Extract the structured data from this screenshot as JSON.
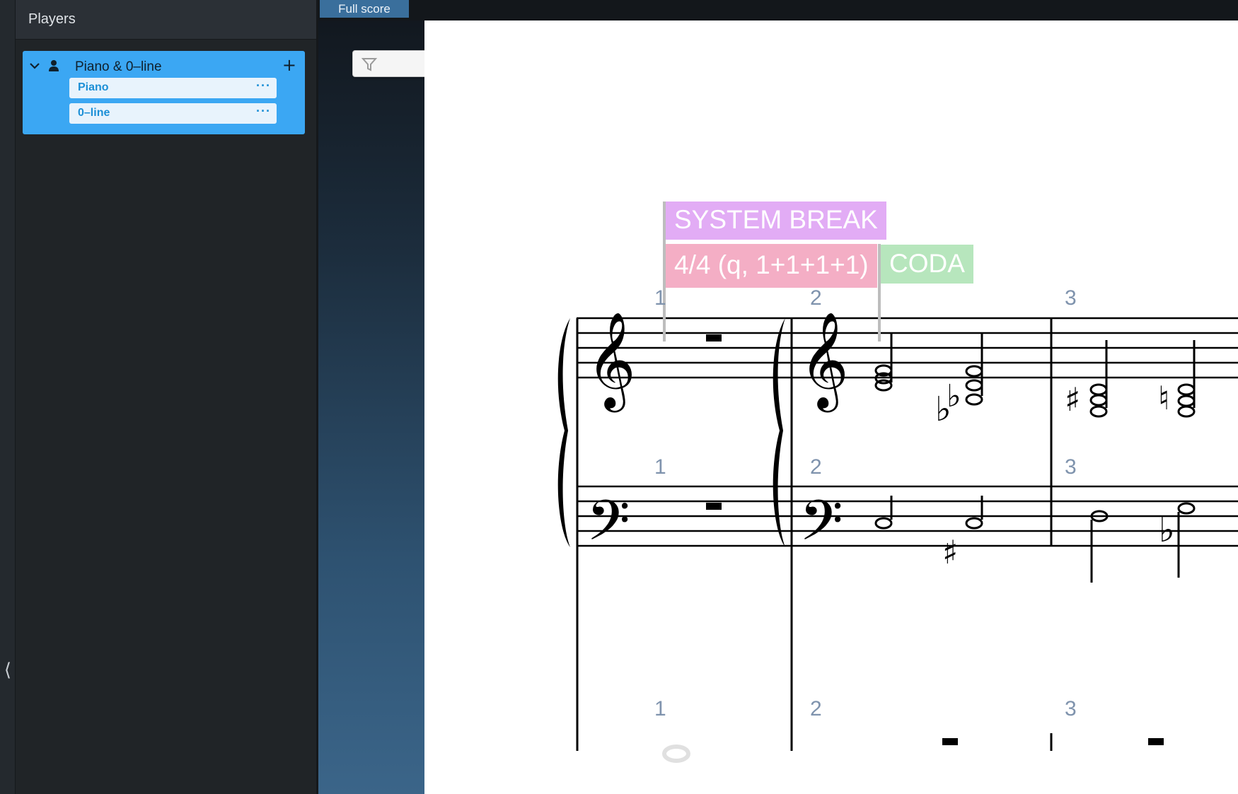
{
  "panel": {
    "title": "Players",
    "collapse_glyph": "⟨",
    "player": {
      "name": "Piano & 0–line",
      "add_glyph": "+",
      "instruments": [
        {
          "label": "Piano",
          "more": "···"
        },
        {
          "label": "0–line",
          "more": "···"
        }
      ]
    }
  },
  "tabs": {
    "full_score": "Full score"
  },
  "filter": {
    "add_glyph": "+",
    "more_glyph": "···"
  },
  "signposts": {
    "system_break": "SYSTEM BREAK",
    "time_signature": "4/4 (q, 1+1+1+1)",
    "coda": "CODA"
  },
  "bar_numbers": {
    "treble": [
      "1",
      "2",
      "3"
    ],
    "bass": [
      "1",
      "2",
      "3"
    ],
    "line": [
      "1",
      "2",
      "3"
    ]
  },
  "colors": {
    "system_break": "#e2acf5",
    "time_signature": "#f4aec5",
    "coda": "#b7e6bd",
    "player_card": "#3ba7f3",
    "bar_number": "#7f93ad"
  },
  "icons": [
    "chevron-down-icon",
    "person-icon",
    "filter-icon",
    "plus-icon",
    "more-icon",
    "collapse-arrow-icon"
  ]
}
